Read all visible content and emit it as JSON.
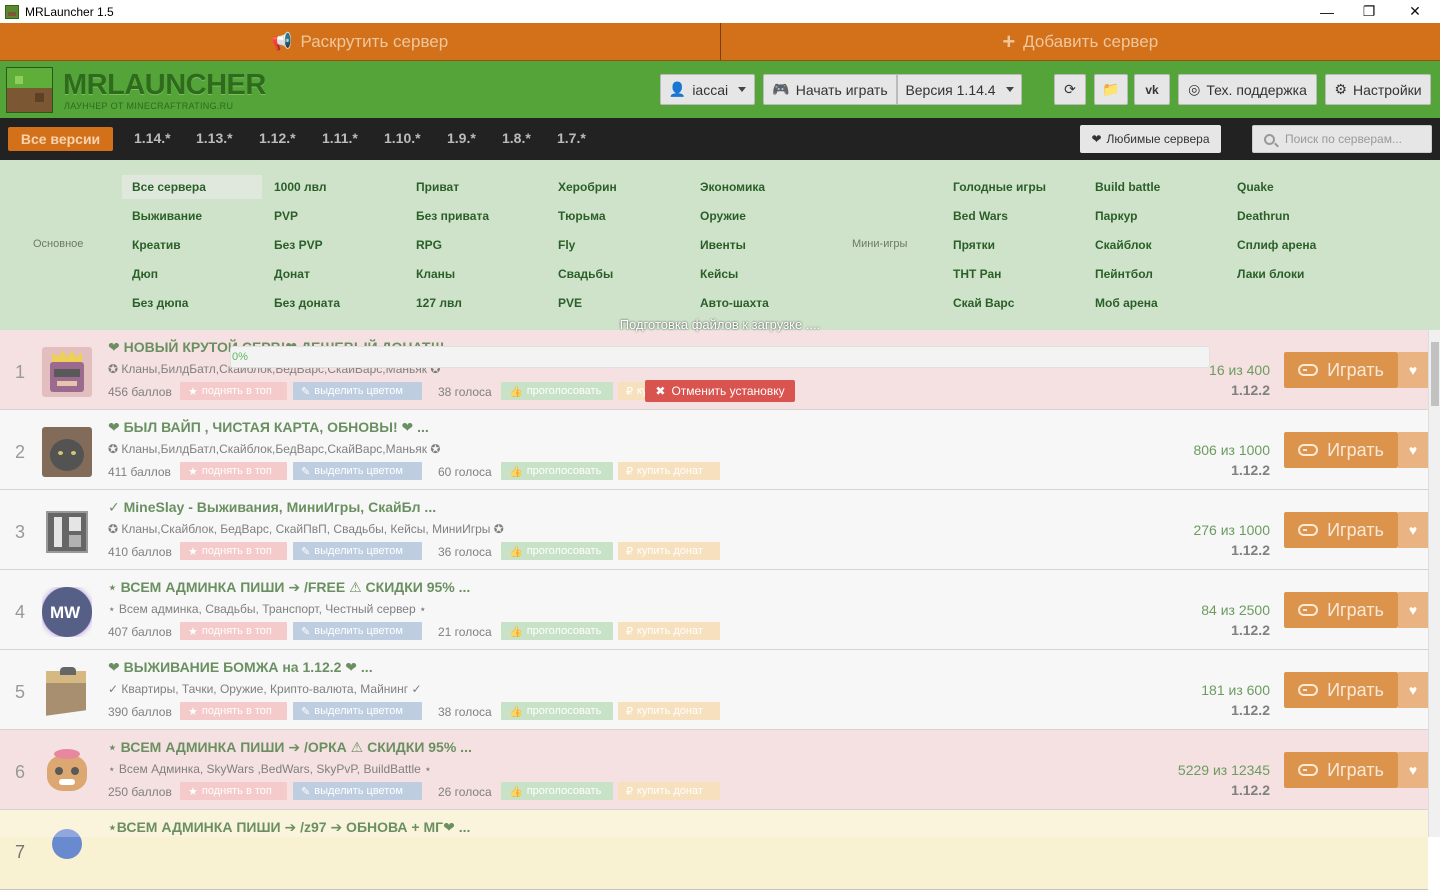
{
  "window": {
    "title": "MRLauncher 1.5",
    "minimize": "—",
    "maximize": "❐",
    "close": "✕"
  },
  "topbar": {
    "promote": "Раскрутить сервер",
    "add": "Добавить сервер"
  },
  "header": {
    "brand": "MRLAUNCHER",
    "brand_sub": "ЛАУНЧЕР ОТ MINECRAFTRATING.RU",
    "user": "iaccai",
    "play": "Начать играть",
    "version": "Версия 1.14.4",
    "support": "Тех. поддержка",
    "settings": "Настройки"
  },
  "versions": {
    "active": "Все версии",
    "items": [
      "1.14.*",
      "1.13.*",
      "1.12.*",
      "1.11.*",
      "1.10.*",
      "1.9.*",
      "1.8.*",
      "1.7.*"
    ],
    "favorites": "Любимые сервера",
    "search_placeholder": "Поиск по серверам..."
  },
  "categories": {
    "main_label": "Основное",
    "mini_label": "Мини-игры",
    "main": [
      [
        "Все сервера",
        "Выживание",
        "Креатив",
        "Дюп",
        "Без дюпа"
      ],
      [
        "1000 лвл",
        "PVP",
        "Без PVP",
        "Донат",
        "Без доната"
      ],
      [
        "Приват",
        "Без привата",
        "RPG",
        "Кланы",
        "127 лвл"
      ],
      [
        "Херобрин",
        "Тюрьма",
        "Fly",
        "Свадьбы",
        "PVE"
      ],
      [
        "Экономика",
        "Оружие",
        "Ивенты",
        "Кейсы",
        "Авто-шахта"
      ]
    ],
    "mini": [
      [
        "Голодные игры",
        "Bed Wars",
        "Прятки",
        "ТНТ Ран",
        "Скай Варс"
      ],
      [
        "Build battle",
        "Паркур",
        "Скайблок",
        "Пейнтбол",
        "Моб арена"
      ],
      [
        "Quake",
        "Deathrun",
        "Сплиф арена",
        "Лаки блоки"
      ]
    ]
  },
  "actions": {
    "raise": "поднять в топ",
    "color": "выделить цветом",
    "vote": "проголосовать",
    "donate": "купить донат",
    "play": "Играть"
  },
  "servers": [
    {
      "rank": "1",
      "title": "❤ НОВЫЙ КРУТОЙ СЕРВ!❤ ДЕШЕВЫЙ ДОНАТ!!!",
      "desc": "✪ Кланы,БилдБатл,Скайблок,БедВарс,СкайВарс,Маньяк ✪",
      "points": "456 баллов",
      "votes": "38 голоса",
      "online": "16 из 400",
      "version": "1.12.2",
      "bg": "#f2d7d7"
    },
    {
      "rank": "2",
      "title": "❤ БЫЛ ВАЙП , ЧИСТАЯ КАРТА, ОБНОВЫ! ❤ ...",
      "desc": "✪ Кланы,БилдБатл,Скайблок,БедВарс,СкайВарс,Маньяк ✪",
      "points": "411 баллов",
      "votes": "60 голоса",
      "online": "806 из 1000",
      "version": "1.12.2",
      "bg": "#f4f4f4"
    },
    {
      "rank": "3",
      "title": "✓ MineSlay - Выживания, МиниИгры, СкайБл ...",
      "desc": "✪ Кланы,Скайблок, БедВарс, СкайПвП, Свадьбы, Кейсы, МиниИгры ✪",
      "points": "410 баллов",
      "votes": "36 голоса",
      "online": "276 из 1000",
      "version": "1.12.2",
      "bg": "#f4f4f4"
    },
    {
      "rank": "4",
      "title": "⋆ ВСЕМ АДМИНКА ПИШИ ➔ /FREE ⚠ СКИДКИ 95% ...",
      "desc": "⋆ Всем админка, Свадьбы, Транспорт, Честный сервер ⋆",
      "points": "407 баллов",
      "votes": "21 голоса",
      "online": "84 из 2500",
      "version": "1.12.2",
      "bg": "#f4f4f4"
    },
    {
      "rank": "5",
      "title": "❤ ВЫЖИВАНИЕ БОМЖА на 1.12.2 ❤ ...",
      "desc": "✓ Квартиры, Тачки, Оружие, Крипто-валюта, Майнинг ✓",
      "points": "390 баллов",
      "votes": "38 голоса",
      "online": "181 из 600",
      "version": "1.12.2",
      "bg": "#f4f4f4"
    },
    {
      "rank": "6",
      "title": "⋆ ВСЕМ АДМИНКА ПИШИ ➔ /ОРКА ⚠ СКИДКИ 95% ...",
      "desc": "⋆ Всем Админка, SkyWars ,BedWars, SkyPvP, BuildBattle ⋆",
      "points": "250 баллов",
      "votes": "26 голоса",
      "online": "5229 из 12345",
      "version": "1.12.2",
      "bg": "#f2d7d7"
    },
    {
      "rank": "7",
      "title": "⋆ВСЕМ АДМИНКА ПИШИ ➔ /z97 ➔ ОБНОВА + МГ❤ ...",
      "desc": "",
      "points": "",
      "votes": "",
      "online": "",
      "version": "",
      "bg": "#f8f1d2"
    }
  ],
  "install": {
    "status": "Подготовка файлов к загрузке ....",
    "progress_text": "0%",
    "progress": 0.0,
    "cancel": "Отменить установку"
  }
}
